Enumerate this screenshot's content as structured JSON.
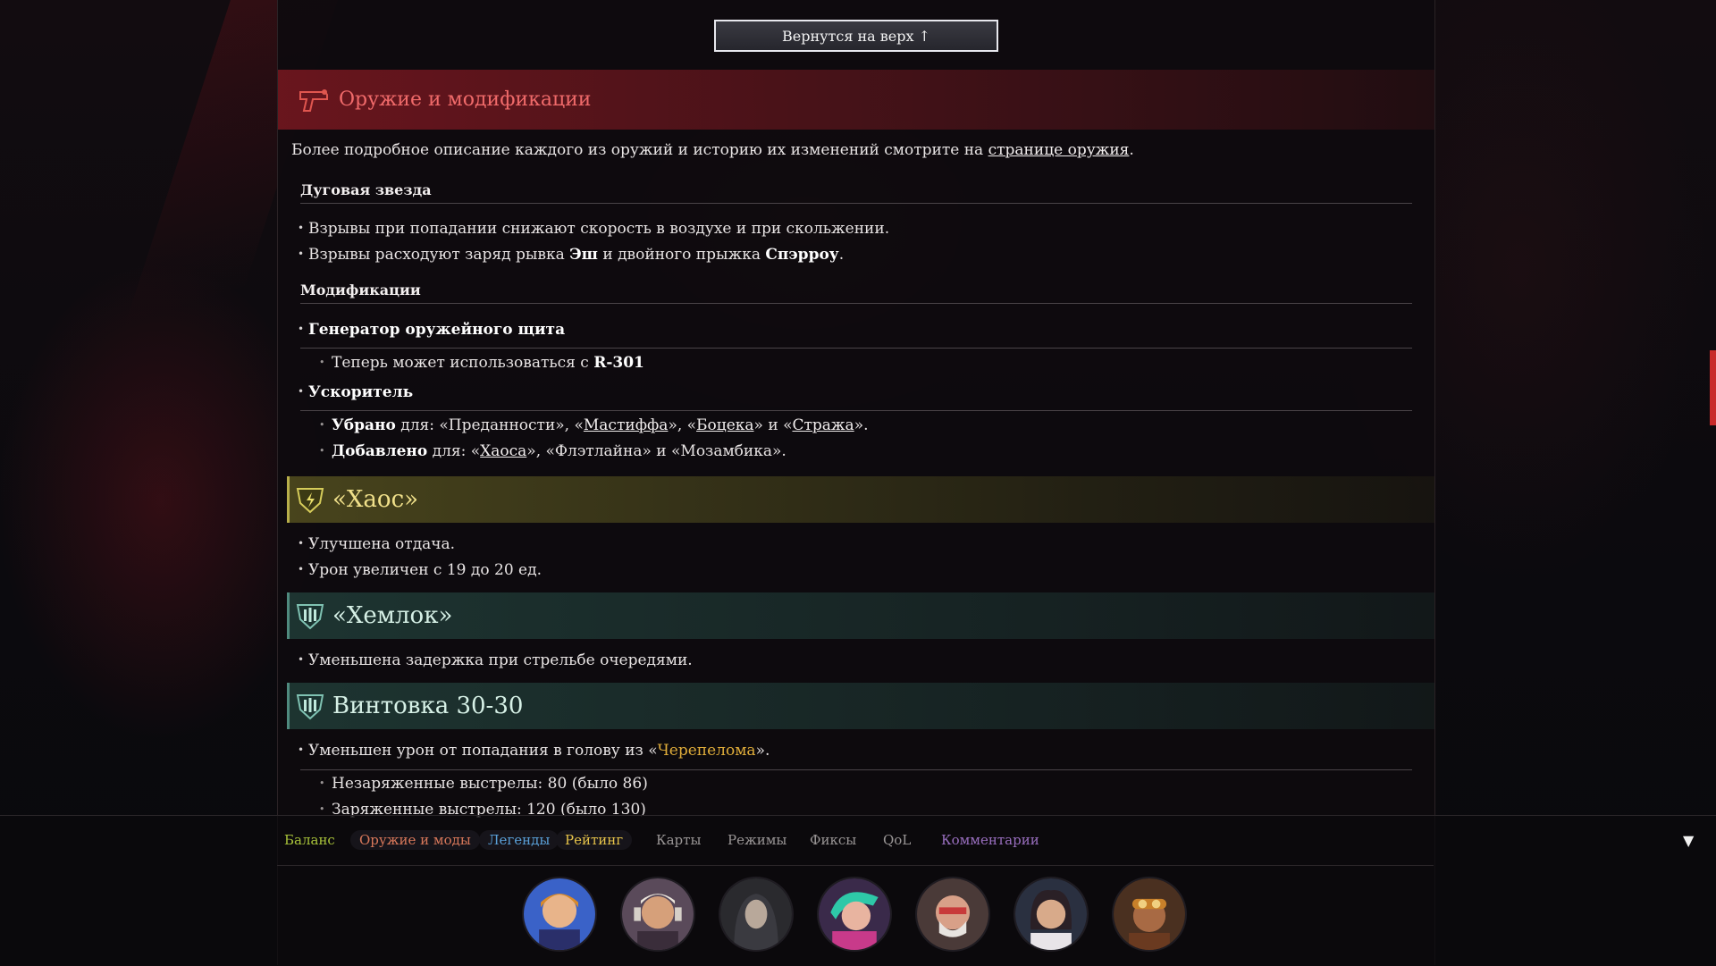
{
  "back_to_top": "Вернутся на верх ↑",
  "section": {
    "title": "Оружие и модификации",
    "icon": "pistol-icon"
  },
  "intro": {
    "text": "Более подробное описание каждого из оружий и историю их изменений смотрите на ",
    "link": "странице оружия",
    "end": "."
  },
  "arcstar": {
    "heading": "Дуговая звезда",
    "items": [
      {
        "text": "Взрывы при попадании снижают скорость в воздухе и при скольжении."
      },
      {
        "pre": "Взрывы расходуют заряд рывка ",
        "b1": "Эш",
        "mid": " и двойного прыжка ",
        "b2": "Спэрроу",
        "end": "."
      }
    ]
  },
  "mods": {
    "heading": "Модификации",
    "shield": {
      "title": "Генератор оружейного щита",
      "sub_pre": "Теперь может использоваться с ",
      "sub_b": "R-301"
    },
    "booster": {
      "title": "Ускоритель",
      "removed": {
        "label": "Убрано",
        "pre": " для: «Преданности», «",
        "l1": "Мастиффа",
        "m1": "», «",
        "l2": "Боцека",
        "m2": "» и «",
        "l3": "Стража",
        "end": "»."
      },
      "added": {
        "label": "Добавлено",
        "pre": " для: «",
        "l1": "Хаоса",
        "end": "», «Флэтлайна» и «Мозамбика»."
      }
    }
  },
  "chaos": {
    "title": "«Хаос»",
    "icon": "energy-ammo-icon",
    "items": [
      "Улучшена отдача.",
      "Урон увеличен с 19 до 20 ед."
    ]
  },
  "hemlok": {
    "title": "«Хемлок»",
    "icon": "heavy-ammo-icon",
    "items": [
      "Уменьшена задержка при стрельбе очередями."
    ]
  },
  "rifle3030": {
    "title": "Винтовка 30-30",
    "icon": "heavy-ammo-icon",
    "item_pre": "Уменьшен урон от попадания в голову из «",
    "item_link": "Черепелома",
    "item_end": "».",
    "subs": [
      "Незаряженные выстрелы: 80 (было 86)",
      "Заряженные выстрелы: 120 (было 130)"
    ]
  },
  "bottom_nav": {
    "tabs": [
      {
        "label": "Баланс",
        "color": "#a8c23a"
      },
      {
        "label": "Оружие и моды",
        "color": "#d8785a"
      },
      {
        "label": "Легенды",
        "color": "#5aa0d8"
      },
      {
        "label": "Рейтинг",
        "color": "#e6c34a"
      },
      {
        "label": "Карты",
        "color": "#9a9696"
      },
      {
        "label": "Режимы",
        "color": "#9a9696"
      },
      {
        "label": "Фиксы",
        "color": "#9a9696"
      },
      {
        "label": "QoL",
        "color": "#9a9696"
      },
      {
        "label": "Комментарии",
        "color": "#9a6fc0"
      }
    ],
    "collapse_icon": "▼"
  },
  "avatars": [
    {
      "name": "legend-avatar-1"
    },
    {
      "name": "legend-avatar-2"
    },
    {
      "name": "legend-avatar-3"
    },
    {
      "name": "legend-avatar-4"
    },
    {
      "name": "legend-avatar-5"
    },
    {
      "name": "legend-avatar-6"
    },
    {
      "name": "legend-avatar-7"
    }
  ]
}
